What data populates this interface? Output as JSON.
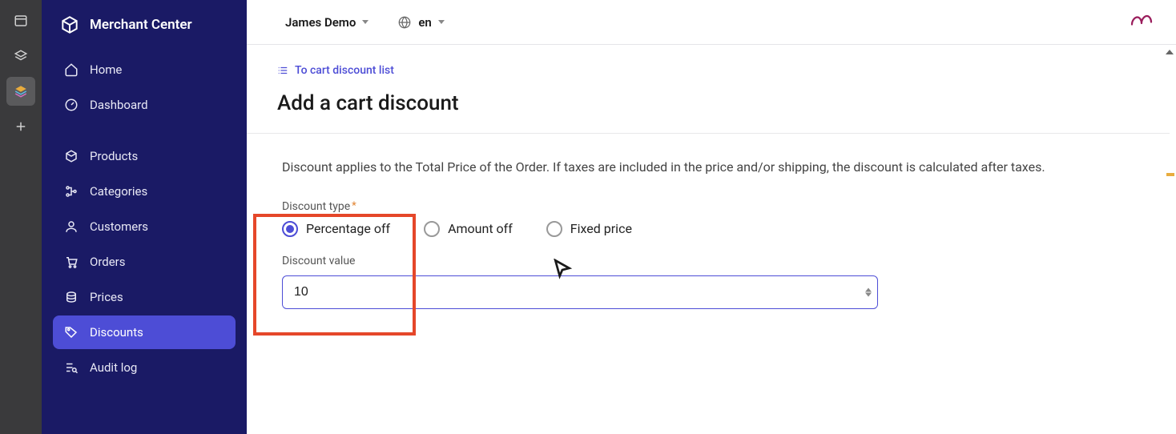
{
  "brand": {
    "title": "Merchant Center"
  },
  "rail": {
    "items": [
      "panel",
      "layers",
      "stack",
      "add"
    ]
  },
  "sidebar": {
    "items": [
      {
        "label": "Home"
      },
      {
        "label": "Dashboard"
      },
      {
        "label": "Products"
      },
      {
        "label": "Categories"
      },
      {
        "label": "Customers"
      },
      {
        "label": "Orders"
      },
      {
        "label": "Prices"
      },
      {
        "label": "Discounts"
      },
      {
        "label": "Audit log"
      }
    ]
  },
  "topbar": {
    "project": "James Demo",
    "locale": "en"
  },
  "content": {
    "back_label": "To cart discount list",
    "title": "Add a cart discount",
    "help": "Discount applies to the Total Price of the Order. If taxes are included in the price and/or shipping, the discount is calculated after taxes.",
    "discount_type_label": "Discount type",
    "options": {
      "percentage": "Percentage off",
      "amount": "Amount off",
      "fixed": "Fixed price"
    },
    "discount_value_label": "Discount value",
    "discount_value": "10"
  }
}
